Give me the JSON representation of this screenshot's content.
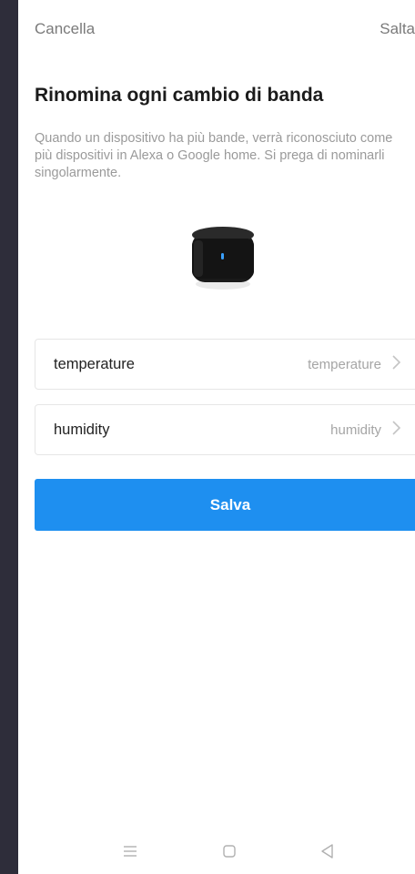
{
  "header": {
    "cancel_label": "Cancella",
    "skip_label": "Salta"
  },
  "page": {
    "title": "Rinomina ogni cambio di banda",
    "description": "Quando un dispositivo ha più bande, verrà riconosciuto come più dispositivi in Alexa o Google home. Si prega di nominarli singolarmente."
  },
  "device": {
    "icon": "smart-ir-hub-icon"
  },
  "fields": [
    {
      "label": "temperature",
      "value": "temperature"
    },
    {
      "label": "humidity",
      "value": "humidity"
    }
  ],
  "actions": {
    "save_label": "Salva"
  },
  "colors": {
    "accent": "#1e8ff0",
    "text_primary": "#1b1b1b",
    "text_secondary": "#9a9a9a",
    "frame": "#2e2d3a"
  },
  "system_nav": {
    "icons": [
      "menu-icon",
      "home-icon",
      "back-icon"
    ]
  }
}
